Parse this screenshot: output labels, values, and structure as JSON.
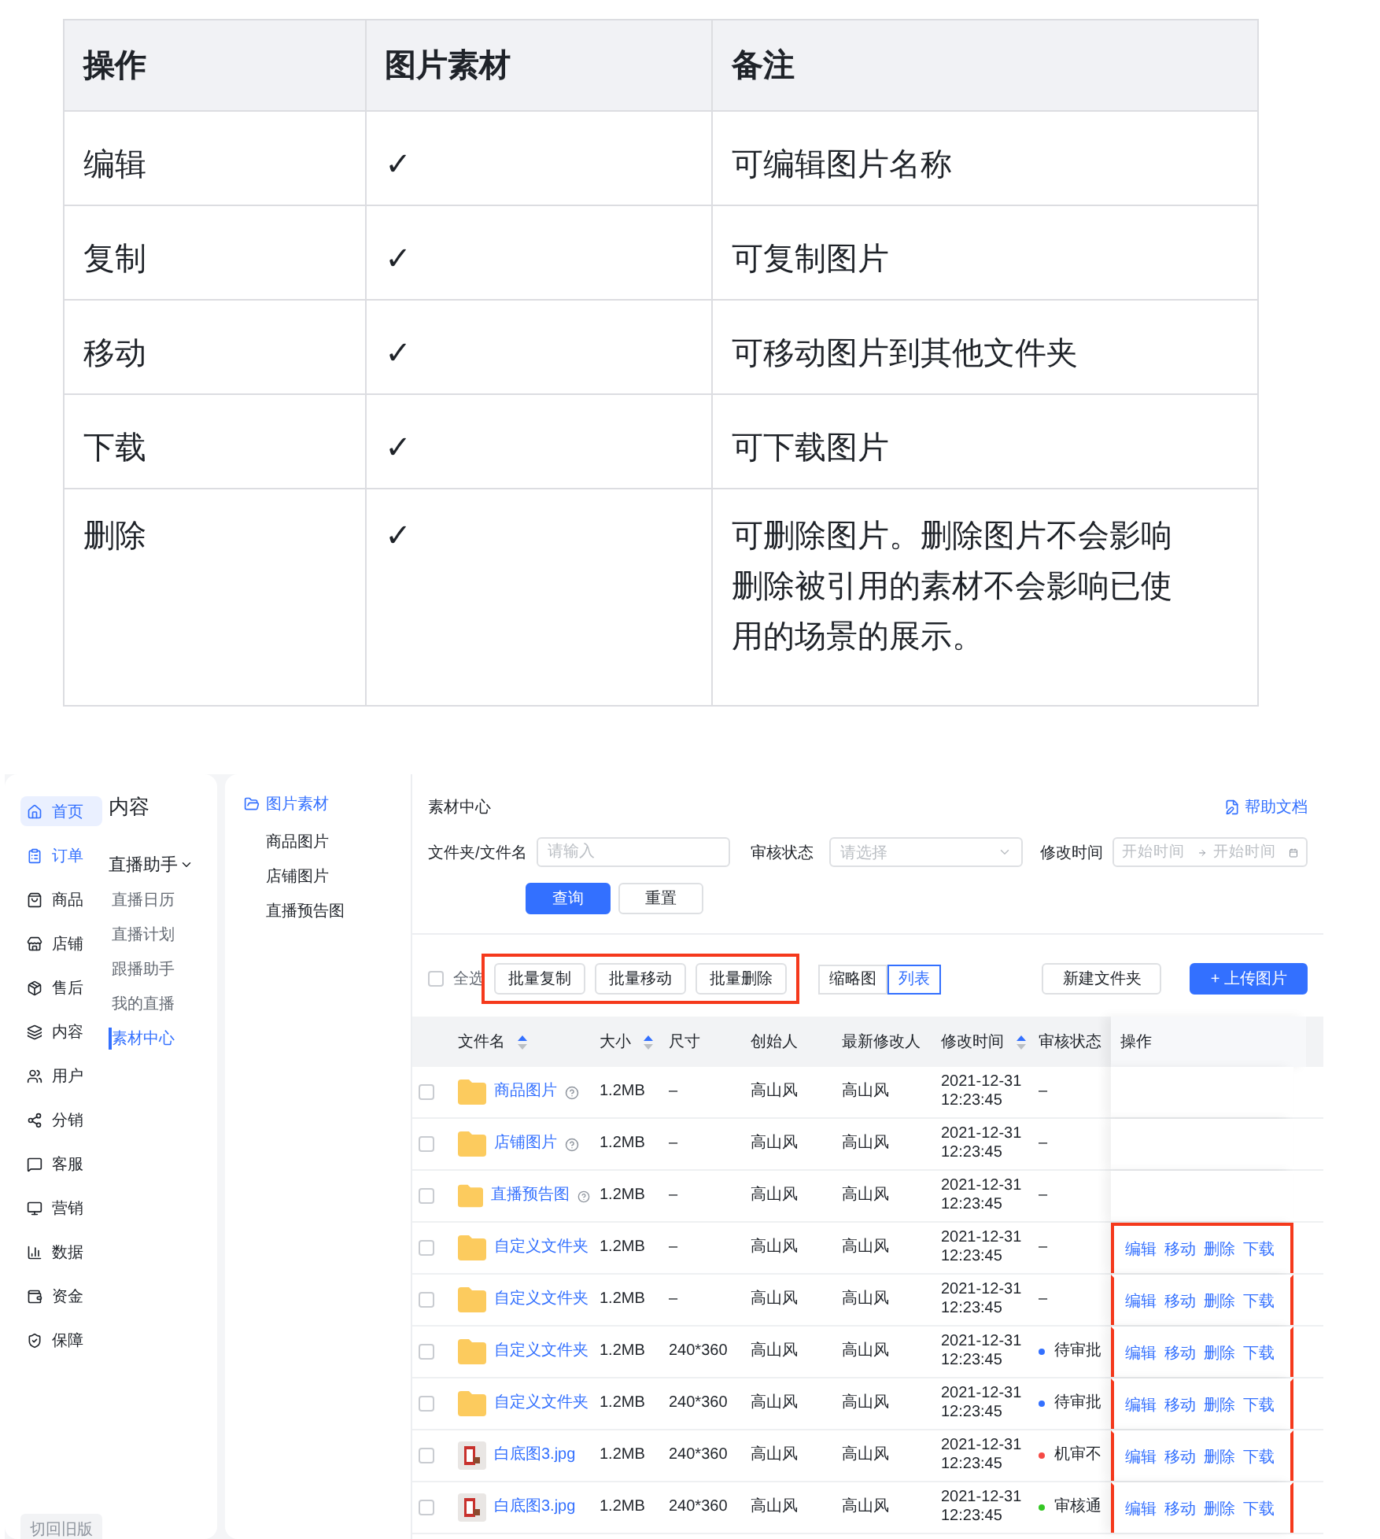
{
  "permissions_table": {
    "columns": [
      "操作",
      "图片素材",
      "备注"
    ],
    "rows": [
      {
        "action": "编辑",
        "mark": "✓",
        "note": "可编辑图片名称"
      },
      {
        "action": "复制",
        "mark": "✓",
        "note": "可复制图片"
      },
      {
        "action": "移动",
        "mark": "✓",
        "note": "可移动图片到其他文件夹"
      },
      {
        "action": "下载",
        "mark": "✓",
        "note": "可下载图片"
      },
      {
        "action": "删除",
        "mark": "✓",
        "note": "可删除图片。删除图片不会影响删除被引用的素材不会影响已使用的场景的展示。"
      }
    ]
  },
  "app": {
    "main_nav": {
      "items": [
        {
          "label": "首页",
          "selected": true,
          "active": true
        },
        {
          "label": "订单",
          "selected": false,
          "active": true
        },
        {
          "label": "商品",
          "selected": false,
          "active": false
        },
        {
          "label": "店铺",
          "selected": false,
          "active": false
        },
        {
          "label": "售后",
          "selected": false,
          "active": false
        },
        {
          "label": "内容",
          "selected": false,
          "active": false
        },
        {
          "label": "用户",
          "selected": false,
          "active": false
        },
        {
          "label": "分销",
          "selected": false,
          "active": false
        },
        {
          "label": "客服",
          "selected": false,
          "active": false
        },
        {
          "label": "营销",
          "selected": false,
          "active": false
        },
        {
          "label": "数据",
          "selected": false,
          "active": false
        },
        {
          "label": "资金",
          "selected": false,
          "active": false
        },
        {
          "label": "保障",
          "selected": false,
          "active": false
        }
      ],
      "footer_button": "切回旧版"
    },
    "sub_nav": {
      "title": "内容",
      "group": {
        "label": "直播助手",
        "expanded": true,
        "items": [
          {
            "label": "直播日历",
            "selected": false
          },
          {
            "label": "直播计划",
            "selected": false
          },
          {
            "label": "跟播助手",
            "selected": false
          },
          {
            "label": "我的直播",
            "selected": false
          },
          {
            "label": "素材中心",
            "selected": true
          }
        ]
      }
    },
    "folder_nav": {
      "title": "图片素材",
      "items": [
        "商品图片",
        "店铺图片",
        "直播预告图"
      ]
    },
    "page_title": "素材中心",
    "help_link": "帮助文档",
    "filters": {
      "name_label": "文件夹/文件名",
      "name_placeholder": "请输入",
      "status_label": "审核状态",
      "status_placeholder": "请选择",
      "time_label": "修改时间",
      "start_placeholder": "开始时间",
      "end_placeholder": "开始时间"
    },
    "search_button": "查询",
    "reset_button": "重置",
    "select_all": {
      "label": "全选",
      "checked": false
    },
    "batch_actions": {
      "highlighted": true,
      "buttons": [
        "批量复制",
        "批量移动",
        "批量删除"
      ]
    },
    "view_toggle": [
      {
        "label": "缩略图",
        "selected": false
      },
      {
        "label": "列表",
        "selected": true
      }
    ],
    "new_folder_button": "新建文件夹",
    "upload_button": "+ 上传图片",
    "table": {
      "columns": [
        {
          "label": "文件名",
          "sortable": true
        },
        {
          "label": "大小",
          "sortable": true
        },
        {
          "label": "尺寸"
        },
        {
          "label": "创始人"
        },
        {
          "label": "最新修改人"
        },
        {
          "label": "修改时间",
          "sortable": true
        },
        {
          "label": "审核状态"
        },
        {
          "label": "操作"
        }
      ],
      "rows": [
        {
          "checked": false,
          "kind": "folder",
          "name": "商品图片",
          "help": true,
          "size": "1.2MB",
          "dimensions": "–",
          "creator": "高山风",
          "modifier": "高山风",
          "modified": "2021-12-31\n12:23:45",
          "status": "–",
          "actions": [],
          "highlighted": false
        },
        {
          "checked": false,
          "kind": "folder",
          "name": "店铺图片",
          "help": true,
          "size": "1.2MB",
          "dimensions": "–",
          "creator": "高山风",
          "modifier": "高山风",
          "modified": "2021-12-31\n12:23:45",
          "status": "–",
          "actions": [],
          "highlighted": false
        },
        {
          "checked": false,
          "kind": "folder",
          "name": "直播预告图",
          "help": true,
          "size": "1.2MB",
          "dimensions": "–",
          "creator": "高山风",
          "modifier": "高山风",
          "modified": "2021-12-31\n12:23:45",
          "status": "–",
          "actions": [],
          "highlighted": false
        },
        {
          "checked": false,
          "kind": "folder",
          "name": "自定义文件夹",
          "size": "1.2MB",
          "dimensions": "–",
          "creator": "高山风",
          "modifier": "高山风",
          "modified": "2021-12-31\n12:23:45",
          "status": "–",
          "actions": [
            "编辑",
            "移动",
            "删除",
            "下载"
          ],
          "highlighted": true
        },
        {
          "checked": false,
          "kind": "folder",
          "name": "自定义文件夹",
          "size": "1.2MB",
          "dimensions": "–",
          "creator": "高山风",
          "modifier": "高山风",
          "modified": "2021-12-31\n12:23:45",
          "status": "–",
          "actions": [
            "编辑",
            "移动",
            "删除",
            "下载"
          ],
          "highlighted": true
        },
        {
          "checked": false,
          "kind": "folder",
          "name": "自定义文件夹",
          "size": "1.2MB",
          "dimensions": "240*360",
          "creator": "高山风",
          "modifier": "高山风",
          "modified": "2021-12-31\n12:23:45",
          "status": "待审批",
          "color": "#3370ff",
          "actions": [
            "编辑",
            "移动",
            "删除",
            "下载"
          ],
          "highlighted": true
        },
        {
          "checked": false,
          "kind": "folder",
          "name": "自定义文件夹",
          "size": "1.2MB",
          "dimensions": "240*360",
          "creator": "高山风",
          "modifier": "高山风",
          "modified": "2021-12-31\n12:23:45",
          "status": "待审批",
          "color": "#3370ff",
          "actions": [
            "编辑",
            "移动",
            "删除",
            "下载"
          ],
          "highlighted": true
        },
        {
          "checked": false,
          "name": "白底图3.jpg",
          "size": "1.2MB",
          "dimensions": "240*360",
          "creator": "高山风",
          "modifier": "高山风",
          "modified": "2021-12-31\n12:23:45",
          "status": "机审不",
          "color": "#f54a45",
          "actions": [
            "编辑",
            "移动",
            "删除",
            "下载"
          ],
          "highlighted": true
        },
        {
          "checked": false,
          "name": "白底图3.jpg",
          "size": "1.2MB",
          "dimensions": "240*360",
          "creator": "高山风",
          "modifier": "高山风",
          "modified": "2021-12-31\n12:23:45",
          "status": "审核通",
          "color": "#34c724",
          "actions": [
            "编辑",
            "移动",
            "删除",
            "下载"
          ],
          "highlighted": true
        }
      ]
    }
  }
}
